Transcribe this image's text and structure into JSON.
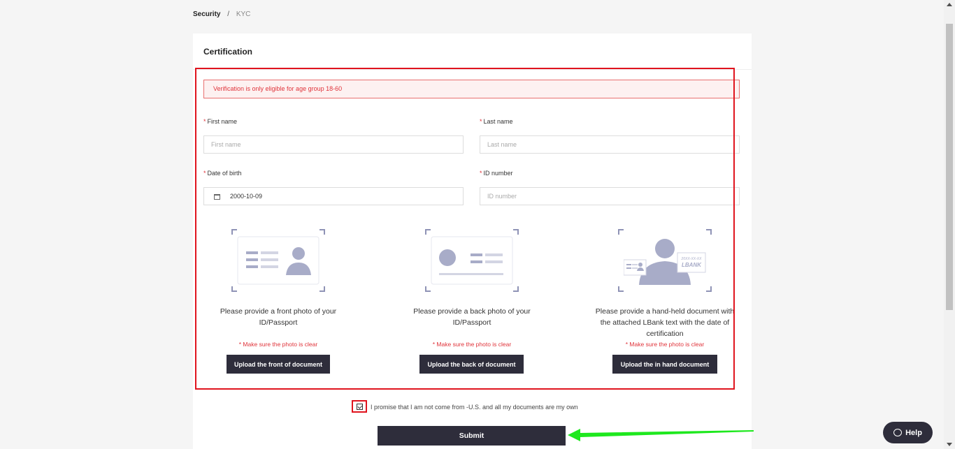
{
  "breadcrumb": {
    "parent": "Security",
    "separator": "/",
    "current": "KYC"
  },
  "card": {
    "title": "Certification"
  },
  "alert": {
    "text": "Verification is only eligible for age group 18-60"
  },
  "form": {
    "required_mark": "*",
    "first_name": {
      "label": "First name",
      "placeholder": "First name",
      "value": ""
    },
    "last_name": {
      "label": "Last name",
      "placeholder": "Last name",
      "value": ""
    },
    "dob": {
      "label": "Date of birth",
      "value": "2000-10-09"
    },
    "id_number": {
      "label": "ID number",
      "placeholder": "ID number",
      "value": ""
    }
  },
  "documents": [
    {
      "caption": "Please provide a front photo of your ID/Passport",
      "note": "* Make sure the photo is clear",
      "button": "Upload the front of document",
      "icon": "id-front-icon"
    },
    {
      "caption": "Please provide a back photo of your ID/Passport",
      "note": "* Make sure the photo is clear",
      "button": "Upload the back of document",
      "icon": "id-back-icon"
    },
    {
      "caption": "Please provide a hand-held document with the attached LBank text with the date of certification",
      "note": "* Make sure the photo is clear",
      "button": "Upload the in hand document",
      "icon": "hand-held-document-icon",
      "paper_text": "20XX-XX-XX",
      "paper_brand": "LBANK"
    }
  ],
  "promise": {
    "checked": true,
    "text": "I promise that I am not come from -U.S. and all my documents are my own"
  },
  "submit": {
    "label": "Submit"
  },
  "help": {
    "label": "Help"
  },
  "colors": {
    "accent_dark": "#2e2d3b",
    "error_red": "#e0333a",
    "highlight_red": "#e0141e",
    "annotation_green": "#1ee81e",
    "illustration": "#a8acc8"
  }
}
